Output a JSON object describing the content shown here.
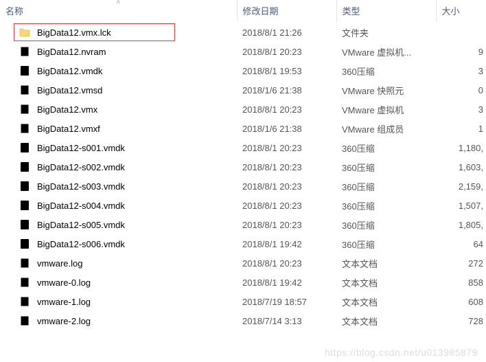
{
  "headers": {
    "name": "名称",
    "date": "修改日期",
    "type": "类型",
    "size": "大小"
  },
  "files": [
    {
      "name": "BigData12.vmx.lck",
      "date": "2018/8/1 21:26",
      "type": "文件夹",
      "size": "",
      "icon": "folder",
      "highlighted": true
    },
    {
      "name": "BigData12.nvram",
      "date": "2018/8/1 20:23",
      "type": "VMware 虚拟机...",
      "size": "9",
      "icon": "vmware"
    },
    {
      "name": "BigData12.vmdk",
      "date": "2018/8/1 19:53",
      "type": "360压缩",
      "size": "3",
      "icon": "vmdk"
    },
    {
      "name": "BigData12.vmsd",
      "date": "2018/1/6 21:38",
      "type": "VMware 快照元",
      "size": "0",
      "icon": "vmware"
    },
    {
      "name": "BigData12.vmx",
      "date": "2018/8/1 20:23",
      "type": "VMware 虚拟机",
      "size": "3",
      "icon": "vmx"
    },
    {
      "name": "BigData12.vmxf",
      "date": "2018/1/6 21:38",
      "type": "VMware 组成员",
      "size": "1",
      "icon": "vmware"
    },
    {
      "name": "BigData12-s001.vmdk",
      "date": "2018/8/1 20:23",
      "type": "360压缩",
      "size": "1,180,",
      "icon": "vmdk"
    },
    {
      "name": "BigData12-s002.vmdk",
      "date": "2018/8/1 20:23",
      "type": "360压缩",
      "size": "1,603,",
      "icon": "vmdk"
    },
    {
      "name": "BigData12-s003.vmdk",
      "date": "2018/8/1 20:23",
      "type": "360压缩",
      "size": "2,159,",
      "icon": "vmdk"
    },
    {
      "name": "BigData12-s004.vmdk",
      "date": "2018/8/1 20:23",
      "type": "360压缩",
      "size": "1,507,",
      "icon": "vmdk"
    },
    {
      "name": "BigData12-s005.vmdk",
      "date": "2018/8/1 20:23",
      "type": "360压缩",
      "size": "1,805,",
      "icon": "vmdk"
    },
    {
      "name": "BigData12-s006.vmdk",
      "date": "2018/8/1 19:42",
      "type": "360压缩",
      "size": "64",
      "icon": "vmdk"
    },
    {
      "name": "vmware.log",
      "date": "2018/8/1 20:23",
      "type": "文本文档",
      "size": "272",
      "icon": "text"
    },
    {
      "name": "vmware-0.log",
      "date": "2018/8/1 19:42",
      "type": "文本文档",
      "size": "858",
      "icon": "text"
    },
    {
      "name": "vmware-1.log",
      "date": "2018/7/19 18:57",
      "type": "文本文档",
      "size": "608",
      "icon": "text"
    },
    {
      "name": "vmware-2.log",
      "date": "2018/7/14 3:13",
      "type": "文本文档",
      "size": "728",
      "icon": "text"
    }
  ],
  "watermark": "https://blog.csdn.net/u013985879"
}
